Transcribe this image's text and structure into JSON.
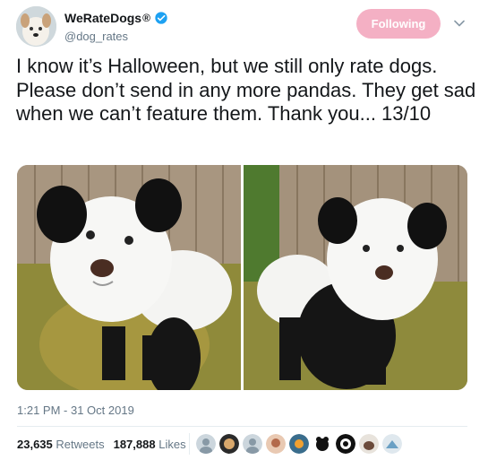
{
  "header": {
    "name": "WeRateDogs",
    "registered": "®",
    "handle": "@dog_rates",
    "follow_label": "Following",
    "verified_icon": "verified-badge-icon",
    "caret_icon": "chevron-down-icon"
  },
  "tweet": {
    "text": "I know it’s Halloween, but we still only rate dogs. Please don’t send in any more pandas. They get sad when we can’t feature them. Thank you... 13/10",
    "timestamp": "1:21 PM - 31 Oct 2019"
  },
  "stats": {
    "retweets_count": "23,635",
    "retweets_label": "Retweets",
    "likes_count": "187,888",
    "likes_label": "Likes"
  },
  "colors": {
    "accent": "#1da1f2",
    "follow_bg": "#f4b0c4",
    "secondary_text": "#657786"
  }
}
